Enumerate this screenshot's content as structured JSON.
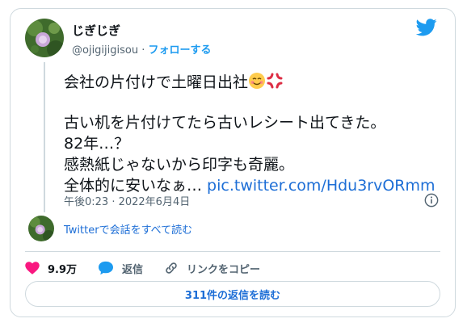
{
  "tweet": {
    "author_name": "じぎじぎ",
    "author_handle": "@ojigijigisou",
    "separator": "·",
    "follow_label": "フォローする",
    "text_line1": "会社の片付けで土曜日出社",
    "text_line2": "古い机を片付けてたら古いレシート出てきた。",
    "text_line3": "82年…？",
    "text_line4": "感熱紙じゃないから印字も奇麗。",
    "text_line5_prefix": "全体的に安いなぁ… ",
    "text_line5_link": "pic.twitter.com/Hdu3rvORmm",
    "timestamp": "午後0:23 · 2022年6月4日",
    "read_conversation": "Twitterで会話をすべて読む",
    "like_count": "9.9万",
    "reply_label": "返信",
    "copy_link_label": "リンクをコピー",
    "read_replies_label": "311件の返信を読む"
  },
  "icons": {
    "brand": "twitter-bird-icon",
    "info": "info-icon",
    "like": "heart-icon",
    "reply": "speech-bubble-icon",
    "copy": "link-icon",
    "emoji1": "smiling-face-emoji",
    "emoji2": "anger-symbol-emoji"
  },
  "colors": {
    "accent": "#1d9bf0",
    "link": "#1d6ed6",
    "heart": "#f91880",
    "border": "#cfd9de",
    "muted": "#536471"
  }
}
